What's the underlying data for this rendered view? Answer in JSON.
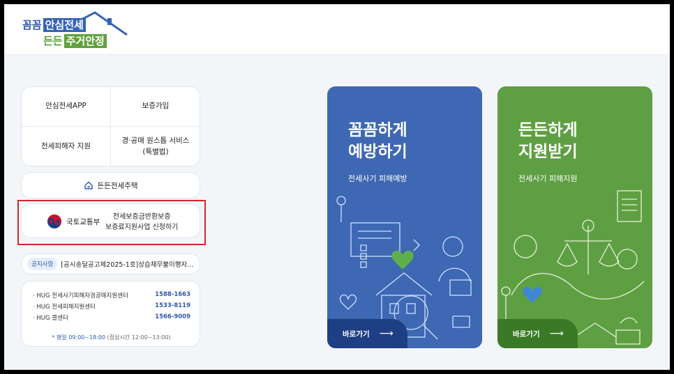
{
  "logo": {
    "line1_pre": "꼼꼼",
    "line1_box": "안심전세",
    "line2_pre": "든든",
    "line2_box": "주거안정"
  },
  "menu": {
    "items": [
      {
        "label": "안심전세APP"
      },
      {
        "label": "보증가입"
      },
      {
        "label": "전세피해자 지원"
      },
      {
        "label": "경·공매 원스톱 서비스\n(특별법)"
      }
    ]
  },
  "house_link": {
    "label": "든든전세주택",
    "icon": "house-icon"
  },
  "ministry": {
    "name": "국토교통부",
    "text_line1": "전세보증금반환보증",
    "text_line2": "보증료지원사업 신청하기"
  },
  "notice": {
    "badge": "공지사항",
    "text": "[공시송달공고제2025-1호]상습채무불이행자…"
  },
  "contacts": [
    {
      "label": "· HUG 전세사기피해자경공매지원센터",
      "number": "1588-1663"
    },
    {
      "label": "· HUG 전세피해지원센터",
      "number": "1533-8119"
    },
    {
      "label": "· HUG 콜센터",
      "number": "1566-9009"
    }
  ],
  "hours": {
    "highlight": "* 평일 09:00~18:00",
    "rest": " (점심시간 12:00~13:00)"
  },
  "cards": {
    "blue": {
      "title1": "꼼꼼하게",
      "title2": "예방하기",
      "subtitle": "전세사기 피해예방",
      "button": "바로가기",
      "color": "#3e68b3"
    },
    "green": {
      "title1": "든든하게",
      "title2": "지원받기",
      "subtitle": "전세사기 피해지원",
      "button": "바로가기",
      "color": "#5f9f43"
    }
  },
  "colors": {
    "highlight_border": "#d8232a",
    "accent_blue": "#2f59a8",
    "accent_green": "#5fa23c"
  }
}
